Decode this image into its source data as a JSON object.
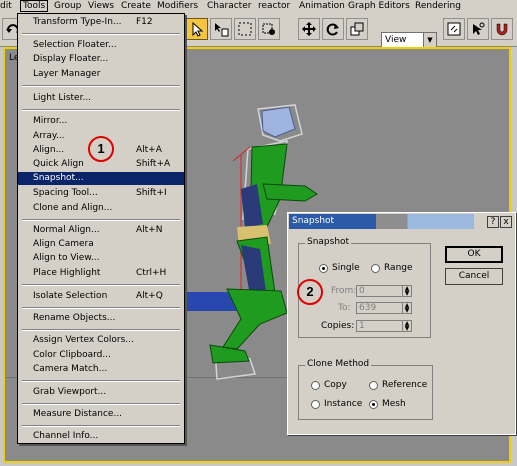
{
  "menubar": {
    "items": [
      "dit",
      "Tools",
      "Group",
      "Views",
      "Create",
      "Modifiers",
      "Character",
      "reactor",
      "Animation",
      "Graph Editors",
      "Rendering"
    ]
  },
  "toolbar": {
    "view_value": "View"
  },
  "viewport": {
    "label": "Le"
  },
  "menu": {
    "items": [
      {
        "label": "Transform Type-In...",
        "shortcut": "F12"
      },
      {
        "label": "Selection Floater..."
      },
      {
        "label": "Display Floater..."
      },
      {
        "label": "Layer Manager"
      },
      {
        "label": "Light Lister..."
      },
      {
        "label": "Mirror..."
      },
      {
        "label": "Array..."
      },
      {
        "label": "Align...",
        "shortcut": "Alt+A"
      },
      {
        "label": "Quick Align",
        "shortcut": "Shift+A"
      },
      {
        "label": "Snapshot..."
      },
      {
        "label": "Spacing Tool...",
        "shortcut": "Shift+I"
      },
      {
        "label": "Clone and Align..."
      },
      {
        "label": "Normal Align...",
        "shortcut": "Alt+N"
      },
      {
        "label": "Align Camera"
      },
      {
        "label": "Align to View..."
      },
      {
        "label": "Place Highlight",
        "shortcut": "Ctrl+H"
      },
      {
        "label": "Isolate Selection",
        "shortcut": "Alt+Q"
      },
      {
        "label": "Rename Objects..."
      },
      {
        "label": "Assign Vertex Colors..."
      },
      {
        "label": "Color Clipboard..."
      },
      {
        "label": "Camera Match..."
      },
      {
        "label": "Grab Viewport..."
      },
      {
        "label": "Measure Distance..."
      },
      {
        "label": "Channel Info..."
      }
    ]
  },
  "markers": {
    "one": "1",
    "two": "2"
  },
  "dialog": {
    "title": "Snapshot",
    "help_label": "?",
    "close_label": "x",
    "snapshot_group": {
      "title": "Snapshot",
      "single_label": "Single",
      "range_label": "Range",
      "selected": "Single",
      "from_label": "From:",
      "from_value": "0",
      "to_label": "To:",
      "to_value": "639",
      "copies_label": "Copies:",
      "copies_value": "1"
    },
    "clone_group": {
      "title": "Clone Method",
      "copy_label": "Copy",
      "reference_label": "Reference",
      "instance_label": "Instance",
      "mesh_label": "Mesh",
      "selected": "Mesh"
    },
    "ok_label": "OK",
    "cancel_label": "Cancel"
  }
}
